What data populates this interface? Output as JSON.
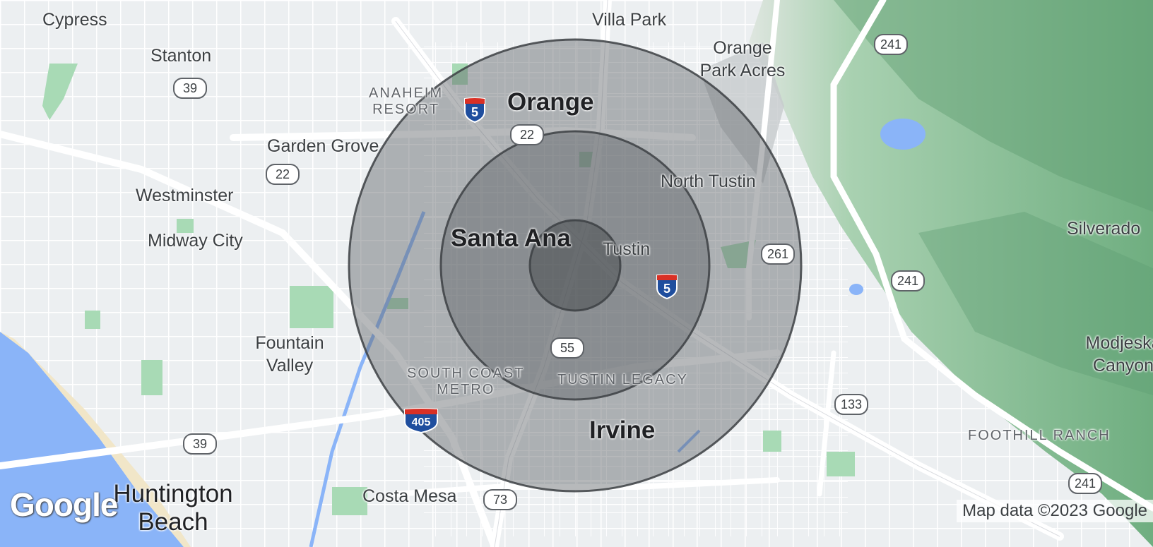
{
  "labels": {
    "cypress": "Cypress",
    "villa_park": "Villa Park",
    "stanton": "Stanton",
    "orange_park_acres": "Orange\nPark Acres",
    "anaheim_resort": "ANAHEIM\nRESORT",
    "orange": "Orange",
    "garden_grove": "Garden Grove",
    "north_tustin": "North Tustin",
    "westminster": "Westminster",
    "silverado": "Silverado",
    "midway_city": "Midway City",
    "santa_ana": "Santa Ana",
    "tustin": "Tustin",
    "fountain_valley": "Fountain\nValley",
    "modjeska_canyon": "Modjeska\nCanyon",
    "south_coast_metro": "SOUTH COAST\nMETRO",
    "tustin_legacy": "TUSTIN LEGACY",
    "foothill_ranch": "FOOTHILL RANCH",
    "irvine": "Irvine",
    "huntington_beach": "Huntington\nBeach",
    "costa_mesa": "Costa Mesa"
  },
  "shields": {
    "sr39_north": "39",
    "sr39_south": "39",
    "sr22_east": "22",
    "sr22_west": "22",
    "sr241_north": "241",
    "sr241_mid": "241",
    "sr241_south": "241",
    "sr261": "261",
    "sr55": "55",
    "sr133": "133",
    "sr73": "73",
    "i5_north": "5",
    "i5_south": "5",
    "i405": "405"
  },
  "logo": "Google",
  "attribution": "Map data ©2023 Google",
  "radius_rings": {
    "count": 3,
    "fill": "#5f6368",
    "stroke": "#3c4043"
  },
  "colors": {
    "land": "#f1f3f4",
    "water": "#8ab4f8",
    "park": "#a8dab5",
    "terrain": "#7fb88f",
    "road": "#ffffff",
    "interstate": "#1f4e9e"
  }
}
